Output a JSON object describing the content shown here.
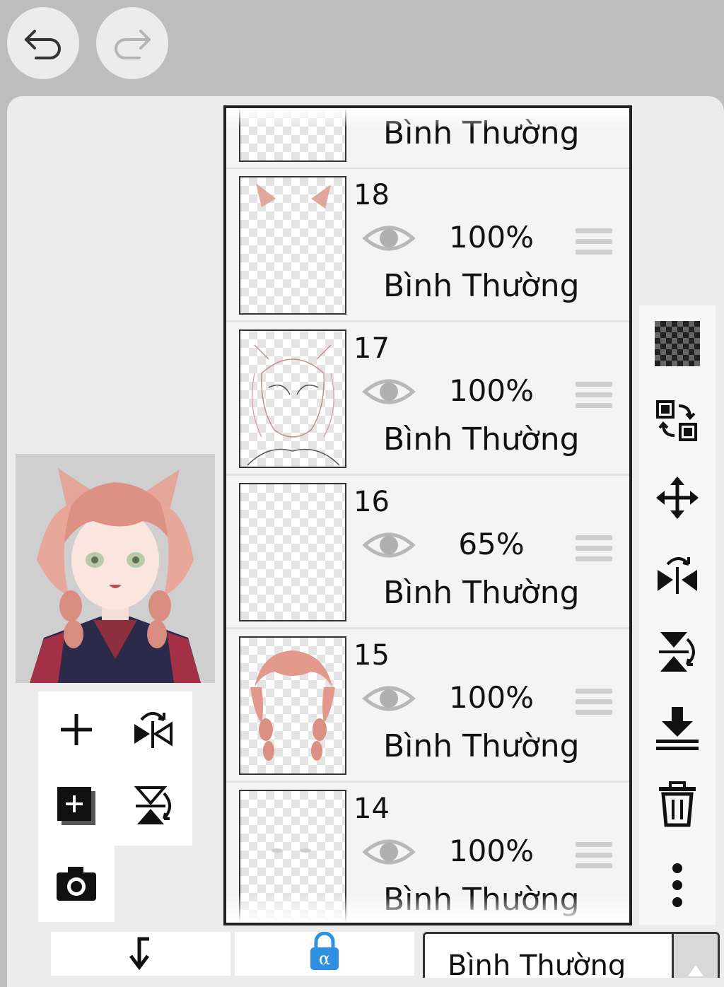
{
  "toolbar": {
    "undo_icon": "undo-icon",
    "redo_icon": "redo-icon"
  },
  "layers": [
    {
      "number": "",
      "opacity": "",
      "blend": "Bình Thường"
    },
    {
      "number": "18",
      "opacity": "100%",
      "blend": "Bình Thường"
    },
    {
      "number": "17",
      "opacity": "100%",
      "blend": "Bình Thường"
    },
    {
      "number": "16",
      "opacity": "65%",
      "blend": "Bình Thường"
    },
    {
      "number": "15",
      "opacity": "100%",
      "blend": "Bình Thường"
    },
    {
      "number": "14",
      "opacity": "100%",
      "blend": "Bình Thường"
    }
  ],
  "left_tools": [
    "add-layer-icon",
    "flip-horizontal-icon",
    "add-folder-icon",
    "flip-vertical-icon",
    "camera-icon"
  ],
  "right_tools": [
    "transparency-grid-icon",
    "swap-layers-icon",
    "move-icon",
    "flip-horizontal-icon",
    "flip-vertical-icon",
    "merge-down-icon",
    "trash-icon",
    "more-options-icon"
  ],
  "bottom": {
    "clip_icon": "clip-arrow-icon",
    "alpha_lock_icon": "alpha-lock-icon",
    "blend_mode": "Bình Thường"
  },
  "colors": {
    "background": "#bdbdbd",
    "panel": "#ececec",
    "accent_blue": "#2f8fe0"
  }
}
